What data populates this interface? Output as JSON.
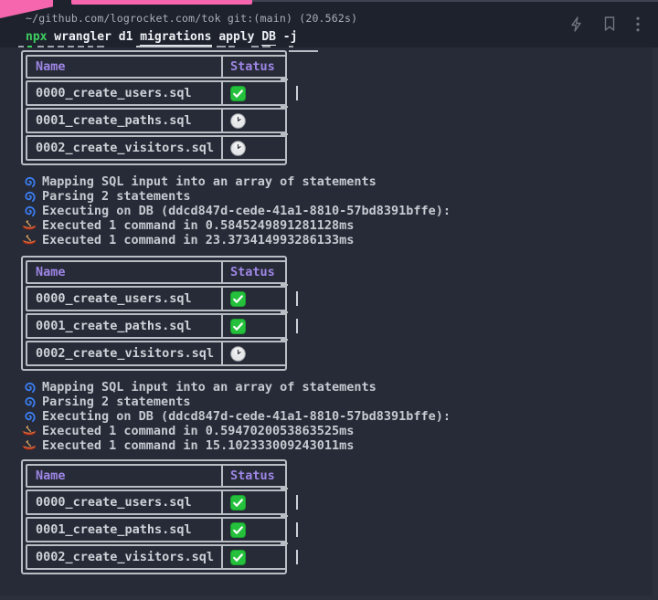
{
  "window": {
    "title": "~/github.com/logrocket.com/tok git:(main) (20.562s)",
    "action_icons": [
      "lightning",
      "bookmark",
      "kebab-menu"
    ]
  },
  "command": {
    "tokens": [
      {
        "text": "npx",
        "style": "green"
      },
      {
        "text": " wrangler d1 ",
        "style": ""
      },
      {
        "text": "migrations",
        "style": "underline"
      },
      {
        "text": " apply ",
        "style": ""
      },
      {
        "text": "DB",
        "style": "underline"
      },
      {
        "text": " -j",
        "style": ""
      }
    ]
  },
  "tables": [
    {
      "headers": [
        "Name",
        "Status"
      ],
      "rows": [
        {
          "name": "0000_create_users.sql",
          "status": "done",
          "cursor": true
        },
        {
          "name": "0001_create_paths.sql",
          "status": "pending",
          "cursor": false
        },
        {
          "name": "0002_create_visitors.sql",
          "status": "pending",
          "cursor": false
        }
      ]
    },
    {
      "headers": [
        "Name",
        "Status"
      ],
      "rows": [
        {
          "name": "0000_create_users.sql",
          "status": "done",
          "cursor": true
        },
        {
          "name": "0001_create_paths.sql",
          "status": "done",
          "cursor": true
        },
        {
          "name": "0002_create_visitors.sql",
          "status": "pending",
          "cursor": false
        }
      ]
    },
    {
      "headers": [
        "Name",
        "Status"
      ],
      "rows": [
        {
          "name": "0000_create_users.sql",
          "status": "done",
          "cursor": true
        },
        {
          "name": "0001_create_paths.sql",
          "status": "done",
          "cursor": true
        },
        {
          "name": "0002_create_visitors.sql",
          "status": "done",
          "cursor": true
        }
      ]
    }
  ],
  "log_blocks": [
    {
      "lines": [
        {
          "icon": "cyclone",
          "text": "Mapping SQL input into an array of statements"
        },
        {
          "icon": "cyclone",
          "text": "Parsing 2 statements"
        },
        {
          "icon": "cyclone",
          "text": "Executing on DB (ddcd847d-cede-41a1-8810-57bd8391bffe):"
        },
        {
          "icon": "canoe",
          "text": "Executed 1 command in 0.5845249891281128ms"
        },
        {
          "icon": "canoe",
          "text": "Executed 1 command in 23.373414993286133ms"
        }
      ]
    },
    {
      "lines": [
        {
          "icon": "cyclone",
          "text": "Mapping SQL input into an array of statements"
        },
        {
          "icon": "cyclone",
          "text": "Parsing 2 statements"
        },
        {
          "icon": "cyclone",
          "text": "Executing on DB (ddcd847d-cede-41a1-8810-57bd8391bffe):"
        },
        {
          "icon": "canoe",
          "text": "Executed 1 command in 0.5947020053863525ms"
        },
        {
          "icon": "canoe",
          "text": "Executed 1 command in 15.102333009243011ms"
        }
      ]
    }
  ],
  "colors": {
    "background": "#272b37",
    "header_background": "#1e222d",
    "accent_pink": "#f666ae",
    "table_border": "#b9bdc4",
    "header_purple": "#9e86e6",
    "prompt_green": "#3ecf60",
    "success_green": "#25c13c",
    "pending_clock_face": "#e6e7e9",
    "cyclone_blue": "#3b7ef2"
  }
}
